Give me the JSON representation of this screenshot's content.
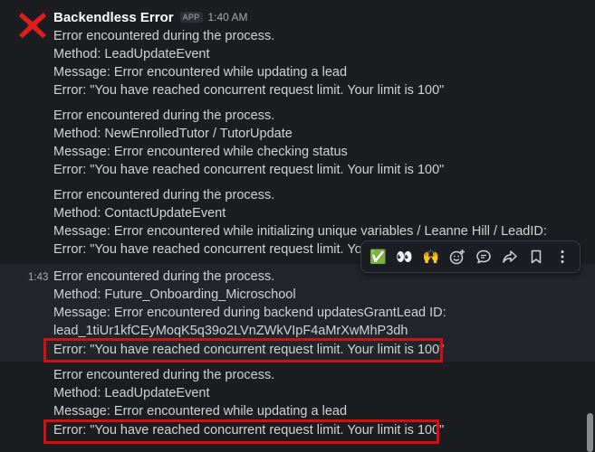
{
  "sender": "Backendless Error",
  "app_badge": "APP",
  "timestamp": "1:40 AM",
  "hover_timestamp": "1:43",
  "messages": [
    {
      "line1": "Error encountered during the process.",
      "line2": "Method: LeadUpdateEvent",
      "line3": "Message: Error encountered while updating a lead",
      "line4": "Error: \"You have reached concurrent request limit. Your limit is 100\""
    },
    {
      "line1": "Error encountered during the process.",
      "line2": "Method: NewEnrolledTutor / TutorUpdate",
      "line3": "Message: Error encountered while checking status",
      "line4": "Error: \"You have reached concurrent request limit. Your limit is 100\""
    },
    {
      "line1": "Error encountered during the process.",
      "line2": "Method: ContactUpdateEvent",
      "line3": "Message: Error encountered while initializing unique variables / Leanne Hill / LeadID:",
      "line4": "Error: \"You have reached concurrent request limit. Your limit is 100\""
    },
    {
      "line1": "Error encountered during the process.",
      "line2": "Method: Future_Onboarding_Microschool",
      "line3": "Message: Error encountered during backend updatesGrantLead ID:",
      "line4": "lead_1tiUr1kfCEyMoqK5q39o2LVnZWkVIpF4aMrXwMhP3dh",
      "line5": "Error: \"You have reached concurrent request limit. Your limit is 100\""
    },
    {
      "line1": "Error encountered during the process.",
      "line2": "Method: LeadUpdateEvent",
      "line3": "Message: Error encountered while updating a lead",
      "line4": "Error: \"You have reached concurrent request limit. Your limit is 100\""
    }
  ],
  "toolbar": {
    "check_emoji": "✅",
    "eyes_emoji": "👀",
    "hands_emoji": "🙌"
  },
  "icons": [
    "x-mark-icon",
    "check-emoji-icon",
    "eyes-emoji-icon",
    "raised-hands-emoji-icon",
    "add-reaction-icon",
    "reply-thread-icon",
    "share-icon",
    "bookmark-icon",
    "more-actions-icon"
  ],
  "colors": {
    "background": "#1b1d21",
    "hover_background": "#222529",
    "text": "#d1d2d3",
    "sender": "#ffffff",
    "muted": "#ababad",
    "highlight_border": "#d40f0f",
    "avatar_red": "#e01e1e"
  }
}
